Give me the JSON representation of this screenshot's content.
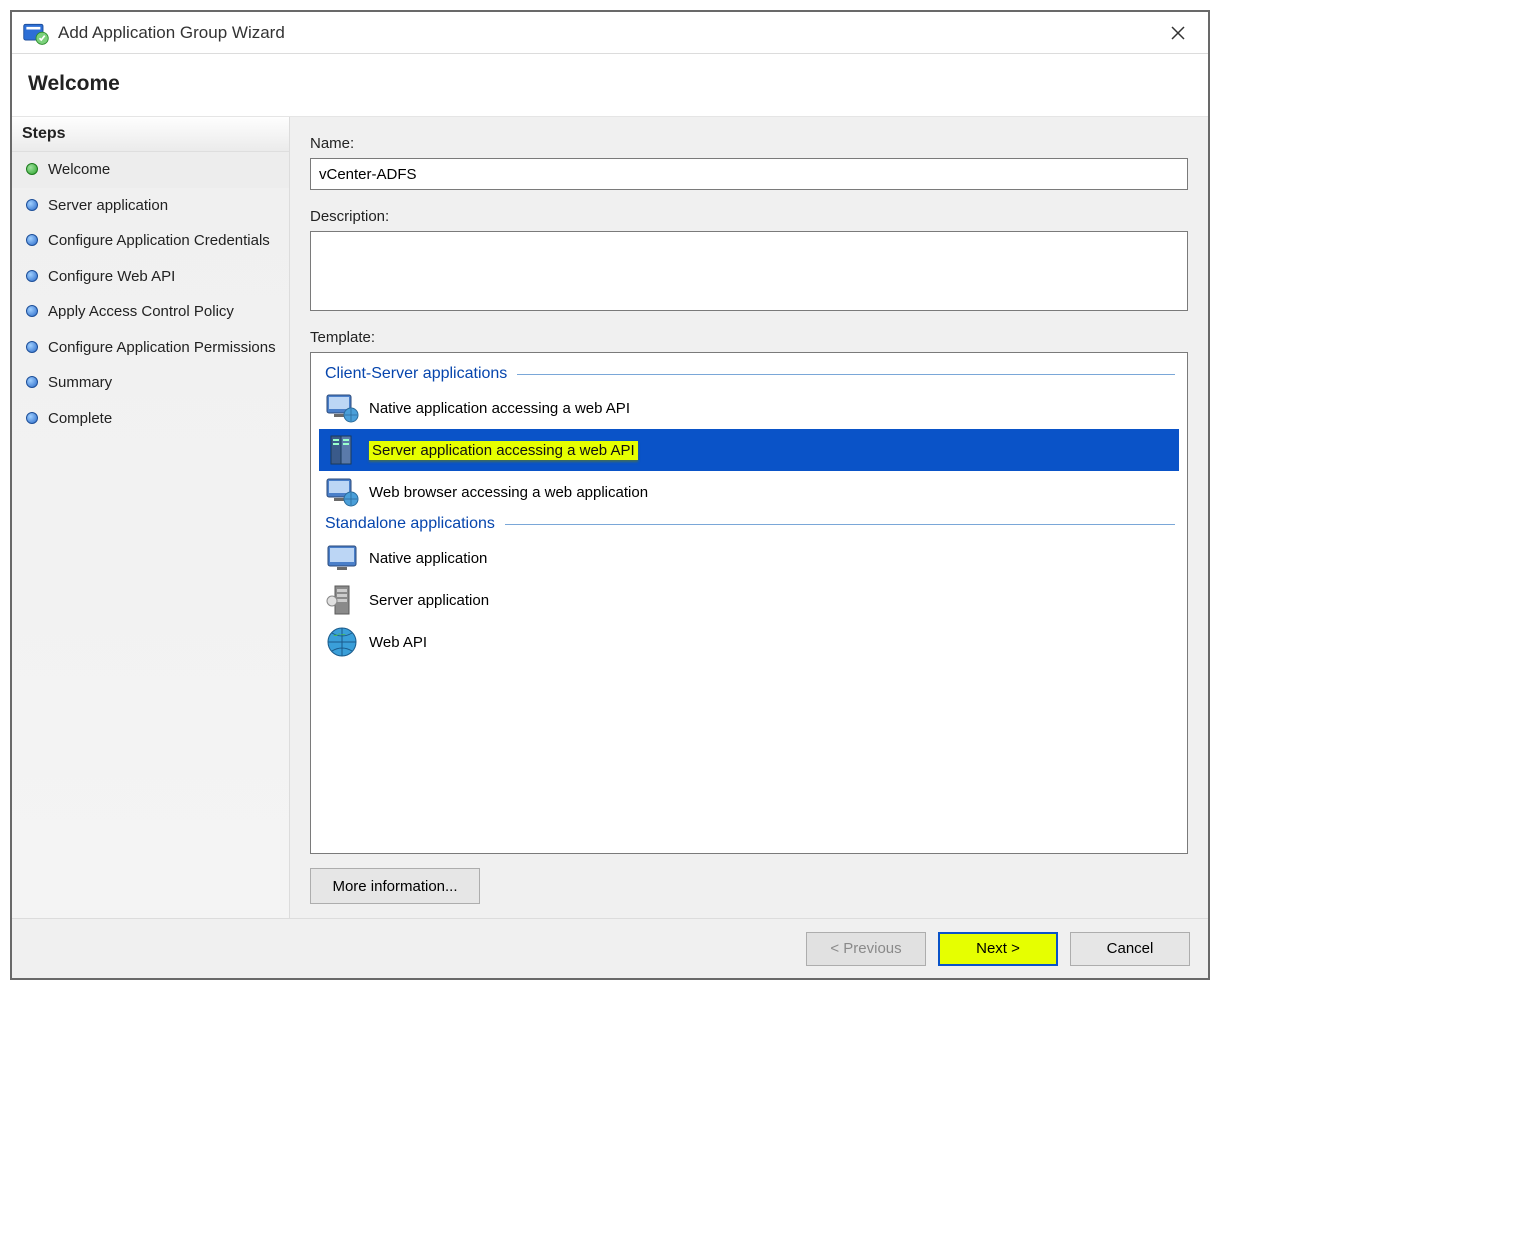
{
  "titlebar": {
    "title": "Add Application Group Wizard"
  },
  "header": {
    "title": "Welcome"
  },
  "sidebar": {
    "title": "Steps",
    "items": [
      {
        "label": "Welcome",
        "bullet": "green",
        "active": true
      },
      {
        "label": "Server application",
        "bullet": "blue",
        "active": false
      },
      {
        "label": "Configure Application Credentials",
        "bullet": "blue",
        "active": false
      },
      {
        "label": "Configure Web API",
        "bullet": "blue",
        "active": false
      },
      {
        "label": "Apply Access Control Policy",
        "bullet": "blue",
        "active": false
      },
      {
        "label": "Configure Application Permissions",
        "bullet": "blue",
        "active": false
      },
      {
        "label": "Summary",
        "bullet": "blue",
        "active": false
      },
      {
        "label": "Complete",
        "bullet": "blue",
        "active": false
      }
    ]
  },
  "form": {
    "name_label": "Name:",
    "name_value": "vCenter-ADFS",
    "description_label": "Description:",
    "description_value": "",
    "template_label": "Template:",
    "groups": [
      {
        "title": "Client-Server applications",
        "items": [
          {
            "label": "Native application accessing a web API",
            "icon": "monitor-globe-icon",
            "selected": false
          },
          {
            "label": "Server application accessing a web API",
            "icon": "server-icon",
            "selected": true
          },
          {
            "label": "Web browser accessing a web application",
            "icon": "monitor-globe-icon",
            "selected": false
          }
        ]
      },
      {
        "title": "Standalone applications",
        "items": [
          {
            "label": "Native application",
            "icon": "monitor-icon",
            "selected": false
          },
          {
            "label": "Server application",
            "icon": "server-rack-icon",
            "selected": false
          },
          {
            "label": "Web API",
            "icon": "globe-icon",
            "selected": false
          }
        ]
      }
    ],
    "more_info_label": "More information..."
  },
  "footer": {
    "previous_label": "< Previous",
    "next_label": "Next >",
    "cancel_label": "Cancel"
  }
}
